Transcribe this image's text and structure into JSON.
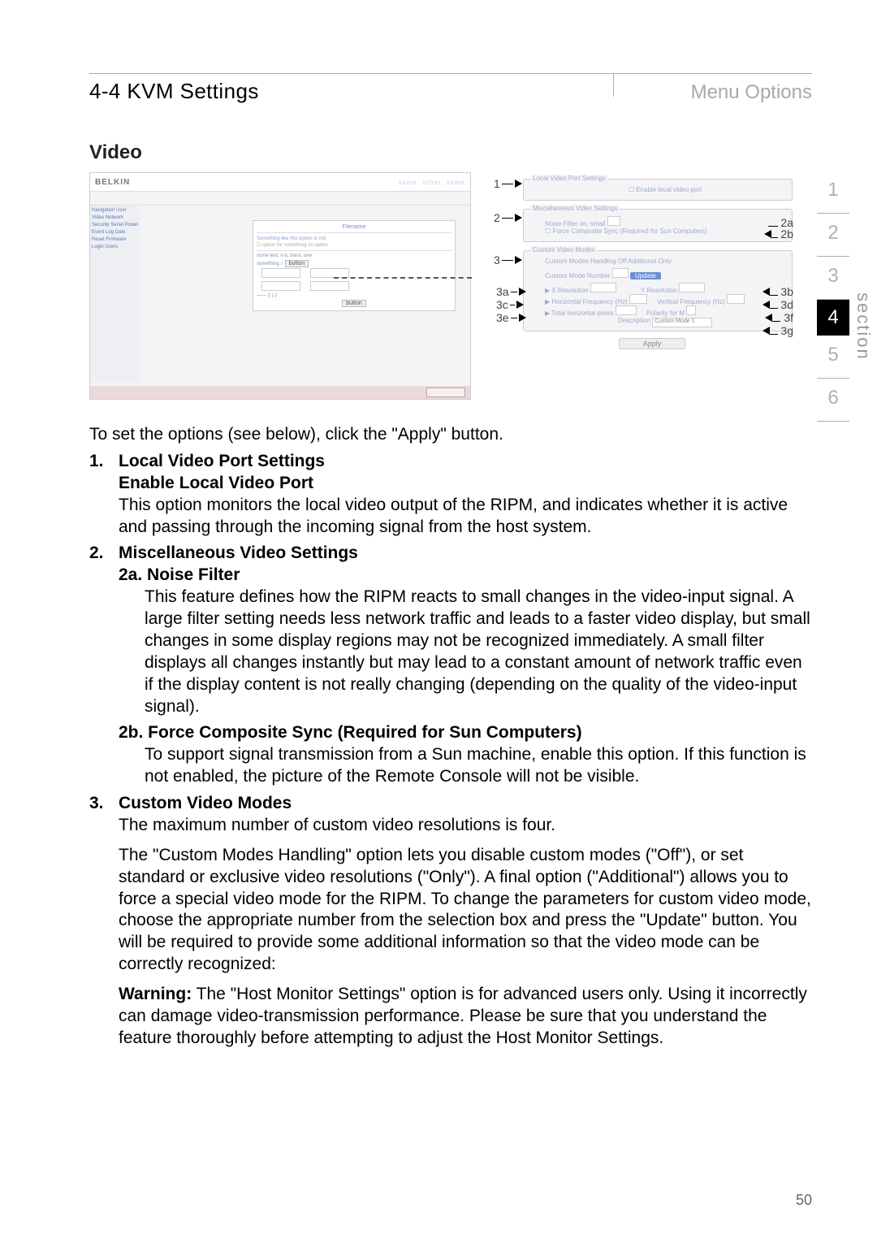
{
  "header": {
    "section_num": "4-4",
    "section_title": "KVM Settings",
    "right": "Menu Options"
  },
  "subheading": "Video",
  "section_label": "section",
  "nav": {
    "items": [
      "1",
      "2",
      "3",
      "4",
      "5",
      "6"
    ],
    "active_index": 3
  },
  "page_number": "50",
  "figure": {
    "brand": "BELKIN",
    "top_links": "some, other, some",
    "sidebar": "Navigation\nUser\nVideo\nNetwork\nSecurity\nSerial\nPower\nEvent Log\nDate\nReset\nFirmware\nLogin Users",
    "panel_title": "Filename",
    "panel_sub1": "Something like this\noption or not",
    "panel_sub2": "some text, n-b, trans, one",
    "btn": "button",
    "callouts": {
      "c1": "1",
      "c2": "2",
      "c3": "3",
      "c2a": "2a",
      "c2b": "2b",
      "c3a": "3a",
      "c3b": "3b",
      "c3c": "3c",
      "c3d": "3d",
      "c3e": "3e",
      "c3f": "3f",
      "c3g": "3g"
    },
    "right_titles": {
      "g1": "Local Video Port Settings",
      "g1_check": "Enable local video port",
      "g2": "Miscellaneous Video Settings",
      "g2_noise": "Noise Filter   on, small",
      "g2_force": "Force Composite Sync (Required for Sun Computers)",
      "g3": "Custom Video Modes",
      "g3_handling": "Custom Modes Handling   Off   Additional   Only",
      "g3_number": "Custom Mode Number",
      "g3_update": "Update",
      "g3_xres": "X Resolution",
      "g3_yres": "Y Resolution",
      "g3_hfreq": "Horizontal Frequency (Hz)",
      "g3_vfreq": "Vertical Frequency (Hz)",
      "g3_total": "Total horizontal pixels",
      "g3_polarity": "Polarity   for M",
      "g3_desc": "Description",
      "g3_descval": "Custom Mode 1",
      "apply": "Apply"
    }
  },
  "text": {
    "intro": "To set the options (see below), click the \"Apply\" button.",
    "s1_num": "1.",
    "s1_title": "Local Video Port Settings",
    "s1_sub": "Enable Local Video Port",
    "s1_body": "This option monitors the local video output of the RIPM, and indicates whether it is active and passing through the incoming signal from the host system.",
    "s2_num": "2.",
    "s2_title": "Miscellaneous Video Settings",
    "s2a_title": "2a. Noise Filter",
    "s2a_body": "This feature defines how the RIPM reacts to small changes in the video-input signal. A large filter setting needs less network traffic and leads to a faster video display, but small changes in some display regions may not be recognized immediately. A small filter displays all changes instantly but may lead to a constant amount of network traffic even if the display content is not really changing (depending on the quality of the video-input signal).",
    "s2b_title": "2b. Force Composite Sync (Required for Sun Computers)",
    "s2b_body": "To support signal transmission from a Sun machine, enable this option. If this function is not enabled, the picture of the Remote Console will not be visible.",
    "s3_num": "3.",
    "s3_title": "Custom Video Modes",
    "s3_body1": "The maximum number of custom video resolutions is four.",
    "s3_body2": "The \"Custom Modes Handling\" option lets you disable custom modes (\"Off\"), or set standard or exclusive video resolutions (\"Only\"). A final option (\"Additional\") allows you to force a special video mode for the RIPM. To change the parameters for custom video mode, choose the appropriate number from the selection box and press the \"Update\" button.  You will be required to provide some additional information so that the video mode can be correctly recognized:",
    "s3_warn_label": "Warning:",
    "s3_warn_body": " The \"Host Monitor Settings\" option is for advanced users only. Using it incorrectly can damage video-transmission performance. Please be sure that you understand the feature thoroughly before attempting to adjust the Host Monitor Settings."
  }
}
